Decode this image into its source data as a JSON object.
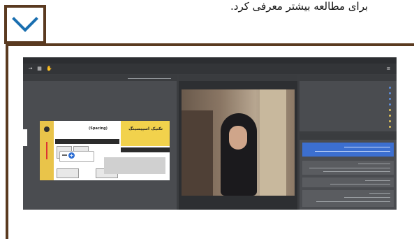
{
  "caption": {
    "text": "برای مطالعه بیشتر معرفی کرد."
  },
  "toggle": {
    "icon": "chevron-down-icon",
    "color": "#1a6fb0"
  },
  "screenshot": {
    "title": "",
    "slide": {
      "title": "تکنیک اسپیسینگ",
      "subtitle": "(Spacing)"
    },
    "participants": [
      {
        "name": ""
      },
      {
        "name": ""
      },
      {
        "name": ""
      },
      {
        "name": ""
      },
      {
        "name": ""
      },
      {
        "name": ""
      },
      {
        "name": ""
      },
      {
        "name": ""
      }
    ]
  }
}
